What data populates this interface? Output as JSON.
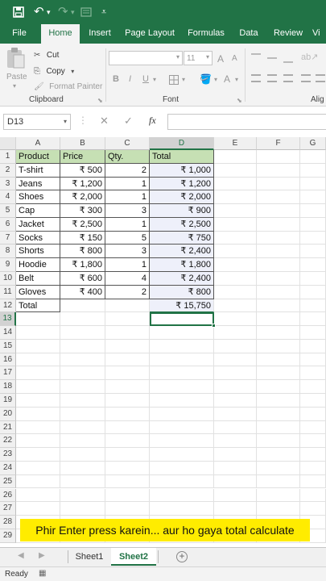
{
  "ribbon_tabs": [
    {
      "label": "File"
    },
    {
      "label": "Home"
    },
    {
      "label": "Insert"
    },
    {
      "label": "Page Layout"
    },
    {
      "label": "Formulas"
    },
    {
      "label": "Data"
    },
    {
      "label": "Review"
    },
    {
      "label": "Vi"
    }
  ],
  "clipboard": {
    "paste": "Paste",
    "cut": "Cut",
    "copy": "Copy",
    "format_painter": "Format Painter",
    "group": "Clipboard"
  },
  "font": {
    "size": "11",
    "group": "Font",
    "bold": "B",
    "italic": "I",
    "underline": "U",
    "grow": "A",
    "shrink": "A",
    "color": "A"
  },
  "align_group": "Alig",
  "formula_bar": {
    "name_box": "D13",
    "fx": "fx",
    "value": ""
  },
  "columns": [
    "A",
    "B",
    "C",
    "D",
    "E",
    "F",
    "G"
  ],
  "rows": [
    "1",
    "2",
    "3",
    "4",
    "5",
    "6",
    "7",
    "8",
    "9",
    "10",
    "11",
    "12",
    "13",
    "14",
    "15",
    "16",
    "17",
    "18",
    "19",
    "20",
    "21",
    "22",
    "23",
    "24",
    "25",
    "26",
    "27",
    "28",
    "29"
  ],
  "headers": [
    "Product",
    "Price",
    "Qty.",
    "Total"
  ],
  "table": [
    [
      "T-shirt",
      "₹ 500",
      "2",
      "₹ 1,000"
    ],
    [
      "Jeans",
      "₹ 1,200",
      "1",
      "₹ 1,200"
    ],
    [
      "Shoes",
      "₹ 2,000",
      "1",
      "₹ 2,000"
    ],
    [
      "Cap",
      "₹ 300",
      "3",
      "₹ 900"
    ],
    [
      "Jacket",
      "₹ 2,500",
      "1",
      "₹ 2,500"
    ],
    [
      "Socks",
      "₹ 150",
      "5",
      "₹ 750"
    ],
    [
      "Shorts",
      "₹ 800",
      "3",
      "₹ 2,400"
    ],
    [
      "Hoodie",
      "₹ 1,800",
      "1",
      "₹ 1,800"
    ],
    [
      "Belt",
      "₹ 600",
      "4",
      "₹ 2,400"
    ],
    [
      "Gloves",
      "₹ 400",
      "2",
      "₹ 800"
    ]
  ],
  "total_row": {
    "label": "Total",
    "value": "₹ 15,750"
  },
  "sheets": [
    "Sheet1",
    "Sheet2"
  ],
  "active_sheet": "Sheet2",
  "status": "Ready",
  "caption": "Phir Enter press karein... aur ho gaya total calculate",
  "colors": {
    "accent": "#217346",
    "header_fill": "#c6e0b4",
    "caption_bg": "#ffec00"
  }
}
